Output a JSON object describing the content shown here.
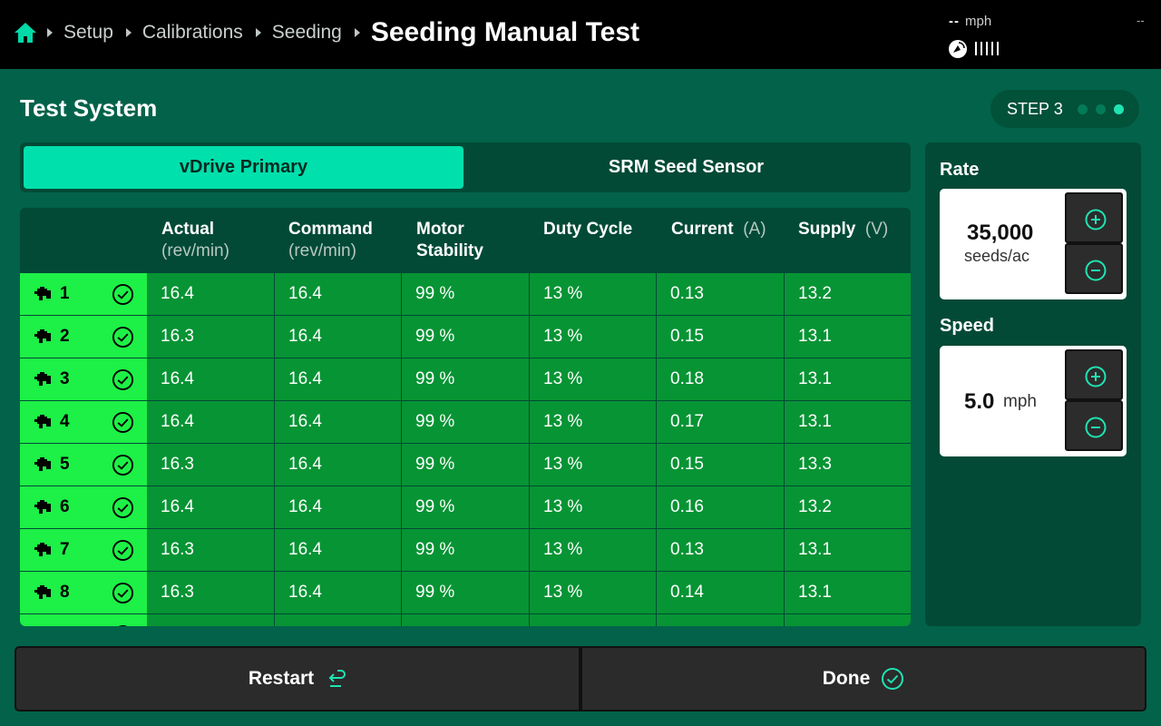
{
  "header": {
    "breadcrumbs": [
      "Setup",
      "Calibrations",
      "Seeding"
    ],
    "title": "Seeding Manual Test",
    "speed_value": "--",
    "speed_unit": "mph",
    "corner_text": "--"
  },
  "section": {
    "title": "Test System",
    "step_label": "STEP 3",
    "step_total": 3,
    "step_current": 3
  },
  "tabs": [
    {
      "label": "vDrive Primary",
      "active": true
    },
    {
      "label": "SRM Seed Sensor",
      "active": false
    }
  ],
  "table": {
    "columns": [
      {
        "name": "Actual",
        "unit": "(rev/min)"
      },
      {
        "name": "Command",
        "unit": "(rev/min)"
      },
      {
        "name": "Motor Stability",
        "unit": ""
      },
      {
        "name": "Duty Cycle",
        "unit": ""
      },
      {
        "name": "Current",
        "unit": "(A)"
      },
      {
        "name": "Supply",
        "unit": "(V)"
      }
    ],
    "rows": [
      {
        "id": "1",
        "actual": "16.4",
        "command": "16.4",
        "stability": "99 %",
        "duty": "13 %",
        "current": "0.13",
        "supply": "13.2"
      },
      {
        "id": "2",
        "actual": "16.3",
        "command": "16.4",
        "stability": "99 %",
        "duty": "13 %",
        "current": "0.15",
        "supply": "13.1"
      },
      {
        "id": "3",
        "actual": "16.4",
        "command": "16.4",
        "stability": "99 %",
        "duty": "13 %",
        "current": "0.18",
        "supply": "13.1"
      },
      {
        "id": "4",
        "actual": "16.4",
        "command": "16.4",
        "stability": "99 %",
        "duty": "13 %",
        "current": "0.17",
        "supply": "13.1"
      },
      {
        "id": "5",
        "actual": "16.3",
        "command": "16.4",
        "stability": "99 %",
        "duty": "13 %",
        "current": "0.15",
        "supply": "13.3"
      },
      {
        "id": "6",
        "actual": "16.4",
        "command": "16.4",
        "stability": "99 %",
        "duty": "13 %",
        "current": "0.16",
        "supply": "13.2"
      },
      {
        "id": "7",
        "actual": "16.3",
        "command": "16.4",
        "stability": "99 %",
        "duty": "13 %",
        "current": "0.13",
        "supply": "13.1"
      },
      {
        "id": "8",
        "actual": "16.3",
        "command": "16.4",
        "stability": "99 %",
        "duty": "13 %",
        "current": "0.14",
        "supply": "13.1"
      },
      {
        "id": "",
        "actual": "",
        "command": "",
        "stability": "",
        "duty": "",
        "current": "",
        "supply": ""
      }
    ]
  },
  "rate": {
    "label": "Rate",
    "value": "35,000",
    "unit": "seeds/ac"
  },
  "speed": {
    "label": "Speed",
    "value": "5.0",
    "unit": "mph"
  },
  "footer": {
    "restart_label": "Restart",
    "done_label": "Done"
  },
  "colors": {
    "background": "#02634a",
    "accent": "#00e0ad",
    "row_ok": "#079434",
    "row_id": "#1df046"
  },
  "icons": [
    "home-icon",
    "gps-icon",
    "signal-icon",
    "motor-icon",
    "check-circle-icon",
    "plus-icon",
    "minus-icon",
    "restart-icon"
  ]
}
